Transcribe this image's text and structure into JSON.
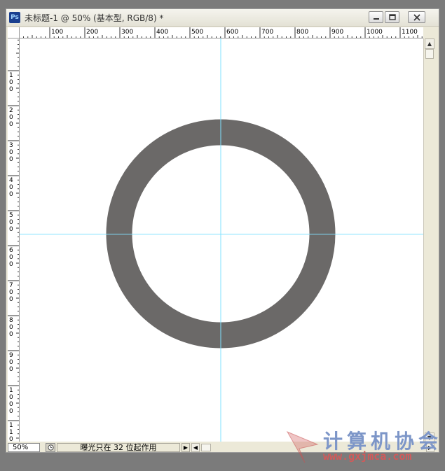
{
  "window": {
    "app_icon_label": "Ps",
    "title": "未标题-1 @ 50% (基本型, RGB/8) *",
    "controls": [
      "minimize-icon",
      "restore-icon",
      "close-icon"
    ]
  },
  "horizontal_ruler": {
    "labels": [
      "100",
      "200",
      "300",
      "400",
      "500",
      "600",
      "700",
      "800",
      "900",
      "1000",
      "1100"
    ]
  },
  "vertical_ruler": {
    "labels": [
      "1 0 0",
      "2 0 0",
      "3 0 0",
      "4 0 0",
      "5 0 0",
      "6 0 0",
      "7 0 0",
      "8 0 0",
      "9 0 0",
      "1 0 0 0",
      "1 1 0 0"
    ]
  },
  "canvas": {
    "background": "#ffffff",
    "ring_color": "#6b6968",
    "guide_color": "#7fe1ff"
  },
  "statusbar": {
    "zoom": "50%",
    "info": "曝光只在 32 位起作用"
  },
  "watermark": {
    "text": "计算机协会",
    "url": "www.gxjmca.com",
    "text_color": "#7d96c8",
    "url_color": "#d25a5a"
  }
}
